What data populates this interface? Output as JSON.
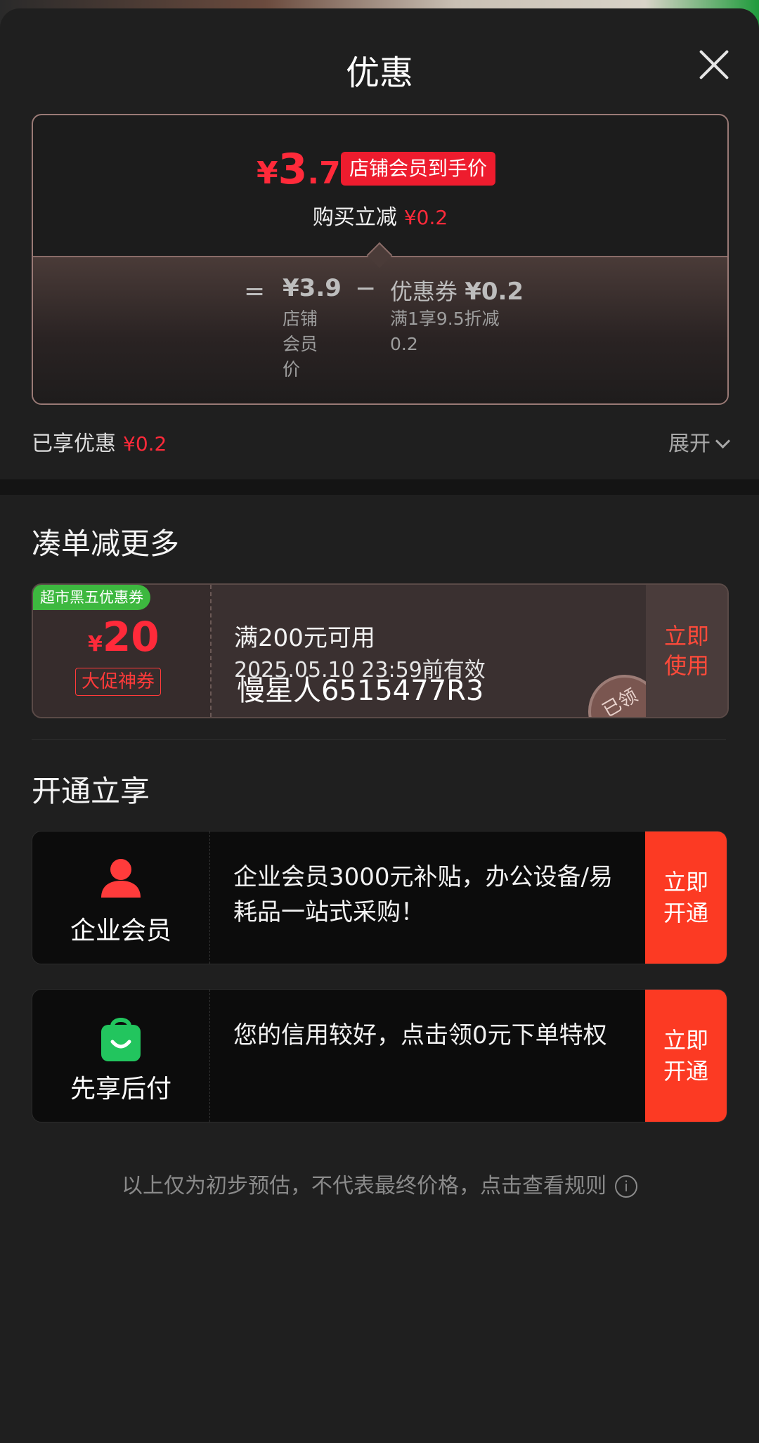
{
  "sheet": {
    "title": "优惠"
  },
  "price_box": {
    "price_yen": "¥",
    "price_int": "3",
    "price_dec": ".7",
    "tag": "店铺会员到手价",
    "buy_label": "购买立减",
    "buy_amount": "¥0.2",
    "equals": "=",
    "member_price": "¥3.9",
    "member_price_label": "店铺会员价",
    "minus": "−",
    "coupon_label": "优惠券",
    "coupon_amount": "¥0.2",
    "coupon_desc": "满1享9.5折减0.2"
  },
  "enjoyed": {
    "label": "已享优惠",
    "amount": "¥0.2",
    "expand": "展开"
  },
  "section_more": {
    "title": "凑单减更多"
  },
  "coupon_card": {
    "badge": "超市黑五优惠券",
    "amount_yen": "¥",
    "amount": "20",
    "label": "大促神券",
    "condition": "满200元可用",
    "validity": "2025.05.10 23:59前有效",
    "watermark": "慢星人6515477R3",
    "action": "立即使用",
    "stamp": "已领"
  },
  "section_open": {
    "title": "开通立享"
  },
  "membership_cards": [
    {
      "name": "企业会员",
      "desc": " 企业会员3000元补贴，办公设备/易耗品一站式采购！",
      "action": "立即开通",
      "icon": "person-icon",
      "icon_color": "#ff3b3b"
    },
    {
      "name": "先享后付",
      "desc": "您的信用较好，点击领0元下单特权",
      "action": "立即开通",
      "icon": "shopping-bag-icon",
      "icon_color": "#22c55e"
    }
  ],
  "footer": {
    "text": "以上仅为初步预估，不代表最终价格，点击查看规则"
  },
  "colors": {
    "accent_red": "#ff2a3a",
    "cta_red": "#fc3a23",
    "badge_green": "#3db83f"
  }
}
